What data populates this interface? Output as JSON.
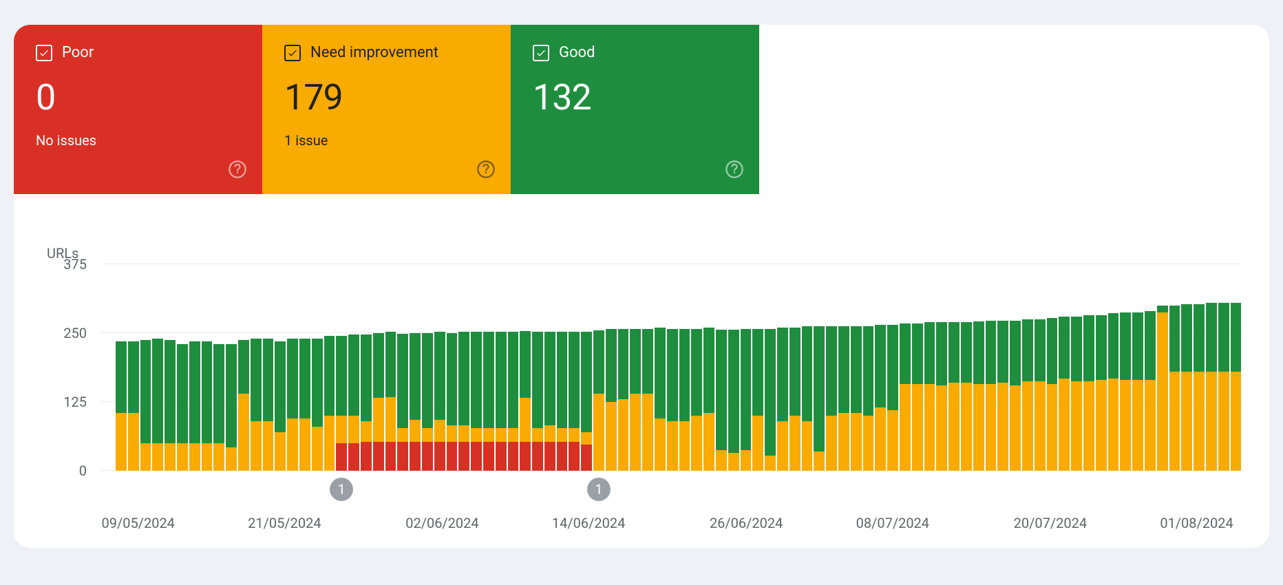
{
  "tiles": {
    "poor": {
      "label": "Poor",
      "count": "0",
      "issues": "No issues"
    },
    "need": {
      "label": "Need improvement",
      "count": "179",
      "issues": "1 issue"
    },
    "good": {
      "label": "Good",
      "count": "132",
      "issues": ""
    }
  },
  "chart_data": {
    "type": "bar",
    "ylabel": "URLs",
    "ylim": [
      0,
      375
    ],
    "y_ticks": [
      0,
      125,
      250,
      375
    ],
    "x_ticks": [
      "09/05/2024",
      "21/05/2024",
      "02/06/2024",
      "14/06/2024",
      "26/06/2024",
      "08/07/2024",
      "20/07/2024",
      "01/08/2024"
    ],
    "x_tick_positions_pct": [
      2,
      15,
      29,
      42,
      56,
      69,
      83,
      96
    ],
    "markers": [
      {
        "index": 18,
        "label": "1"
      },
      {
        "index": 39,
        "label": "1"
      }
    ],
    "series_order": [
      "poor",
      "need",
      "good"
    ],
    "colors": {
      "poor": "#d93025",
      "need": "#f9ab00",
      "good": "#1e8e3e"
    },
    "bars": [
      {
        "p": 0,
        "n": 105,
        "g": 130
      },
      {
        "p": 0,
        "n": 105,
        "g": 130
      },
      {
        "p": 0,
        "n": 50,
        "g": 188
      },
      {
        "p": 0,
        "n": 50,
        "g": 190
      },
      {
        "p": 0,
        "n": 50,
        "g": 188
      },
      {
        "p": 0,
        "n": 50,
        "g": 180
      },
      {
        "p": 0,
        "n": 50,
        "g": 185
      },
      {
        "p": 0,
        "n": 50,
        "g": 185
      },
      {
        "p": 0,
        "n": 50,
        "g": 180
      },
      {
        "p": 0,
        "n": 42,
        "g": 188
      },
      {
        "p": 0,
        "n": 140,
        "g": 98
      },
      {
        "p": 0,
        "n": 90,
        "g": 150
      },
      {
        "p": 0,
        "n": 90,
        "g": 150
      },
      {
        "p": 0,
        "n": 70,
        "g": 165
      },
      {
        "p": 0,
        "n": 95,
        "g": 145
      },
      {
        "p": 0,
        "n": 95,
        "g": 145
      },
      {
        "p": 0,
        "n": 80,
        "g": 160
      },
      {
        "p": 0,
        "n": 100,
        "g": 145
      },
      {
        "p": 50,
        "n": 50,
        "g": 145
      },
      {
        "p": 50,
        "n": 50,
        "g": 148
      },
      {
        "p": 52,
        "n": 38,
        "g": 158
      },
      {
        "p": 52,
        "n": 80,
        "g": 118
      },
      {
        "p": 52,
        "n": 82,
        "g": 118
      },
      {
        "p": 52,
        "n": 25,
        "g": 172
      },
      {
        "p": 52,
        "n": 40,
        "g": 158
      },
      {
        "p": 52,
        "n": 25,
        "g": 173
      },
      {
        "p": 52,
        "n": 40,
        "g": 160
      },
      {
        "p": 52,
        "n": 30,
        "g": 168
      },
      {
        "p": 52,
        "n": 30,
        "g": 170
      },
      {
        "p": 52,
        "n": 25,
        "g": 175
      },
      {
        "p": 52,
        "n": 25,
        "g": 175
      },
      {
        "p": 52,
        "n": 25,
        "g": 176
      },
      {
        "p": 52,
        "n": 25,
        "g": 176
      },
      {
        "p": 52,
        "n": 80,
        "g": 122
      },
      {
        "p": 52,
        "n": 25,
        "g": 175
      },
      {
        "p": 52,
        "n": 30,
        "g": 170
      },
      {
        "p": 52,
        "n": 25,
        "g": 175
      },
      {
        "p": 52,
        "n": 25,
        "g": 175
      },
      {
        "p": 48,
        "n": 22,
        "g": 182
      },
      {
        "p": 0,
        "n": 140,
        "g": 115
      },
      {
        "p": 0,
        "n": 125,
        "g": 133
      },
      {
        "p": 0,
        "n": 130,
        "g": 128
      },
      {
        "p": 0,
        "n": 140,
        "g": 118
      },
      {
        "p": 0,
        "n": 140,
        "g": 118
      },
      {
        "p": 0,
        "n": 95,
        "g": 165
      },
      {
        "p": 0,
        "n": 90,
        "g": 168
      },
      {
        "p": 0,
        "n": 90,
        "g": 168
      },
      {
        "p": 0,
        "n": 100,
        "g": 158
      },
      {
        "p": 0,
        "n": 105,
        "g": 155
      },
      {
        "p": 0,
        "n": 38,
        "g": 218
      },
      {
        "p": 0,
        "n": 33,
        "g": 223
      },
      {
        "p": 0,
        "n": 38,
        "g": 220
      },
      {
        "p": 0,
        "n": 100,
        "g": 158
      },
      {
        "p": 0,
        "n": 28,
        "g": 230
      },
      {
        "p": 0,
        "n": 90,
        "g": 170
      },
      {
        "p": 0,
        "n": 100,
        "g": 160
      },
      {
        "p": 0,
        "n": 90,
        "g": 172
      },
      {
        "p": 0,
        "n": 35,
        "g": 228
      },
      {
        "p": 0,
        "n": 100,
        "g": 162
      },
      {
        "p": 0,
        "n": 105,
        "g": 158
      },
      {
        "p": 0,
        "n": 105,
        "g": 158
      },
      {
        "p": 0,
        "n": 100,
        "g": 163
      },
      {
        "p": 0,
        "n": 115,
        "g": 150
      },
      {
        "p": 0,
        "n": 110,
        "g": 155
      },
      {
        "p": 0,
        "n": 158,
        "g": 110
      },
      {
        "p": 0,
        "n": 158,
        "g": 110
      },
      {
        "p": 0,
        "n": 158,
        "g": 112
      },
      {
        "p": 0,
        "n": 155,
        "g": 115
      },
      {
        "p": 0,
        "n": 160,
        "g": 110
      },
      {
        "p": 0,
        "n": 160,
        "g": 110
      },
      {
        "p": 0,
        "n": 158,
        "g": 113
      },
      {
        "p": 0,
        "n": 158,
        "g": 115
      },
      {
        "p": 0,
        "n": 160,
        "g": 113
      },
      {
        "p": 0,
        "n": 155,
        "g": 118
      },
      {
        "p": 0,
        "n": 162,
        "g": 113
      },
      {
        "p": 0,
        "n": 162,
        "g": 113
      },
      {
        "p": 0,
        "n": 158,
        "g": 120
      },
      {
        "p": 0,
        "n": 168,
        "g": 112
      },
      {
        "p": 0,
        "n": 162,
        "g": 118
      },
      {
        "p": 0,
        "n": 162,
        "g": 120
      },
      {
        "p": 0,
        "n": 165,
        "g": 118
      },
      {
        "p": 0,
        "n": 168,
        "g": 118
      },
      {
        "p": 0,
        "n": 165,
        "g": 122
      },
      {
        "p": 0,
        "n": 165,
        "g": 122
      },
      {
        "p": 0,
        "n": 165,
        "g": 125
      },
      {
        "p": 0,
        "n": 288,
        "g": 12
      },
      {
        "p": 0,
        "n": 180,
        "g": 120
      },
      {
        "p": 0,
        "n": 180,
        "g": 122
      },
      {
        "p": 0,
        "n": 180,
        "g": 122
      },
      {
        "p": 0,
        "n": 180,
        "g": 125
      },
      {
        "p": 0,
        "n": 180,
        "g": 125
      },
      {
        "p": 0,
        "n": 180,
        "g": 125
      }
    ]
  }
}
